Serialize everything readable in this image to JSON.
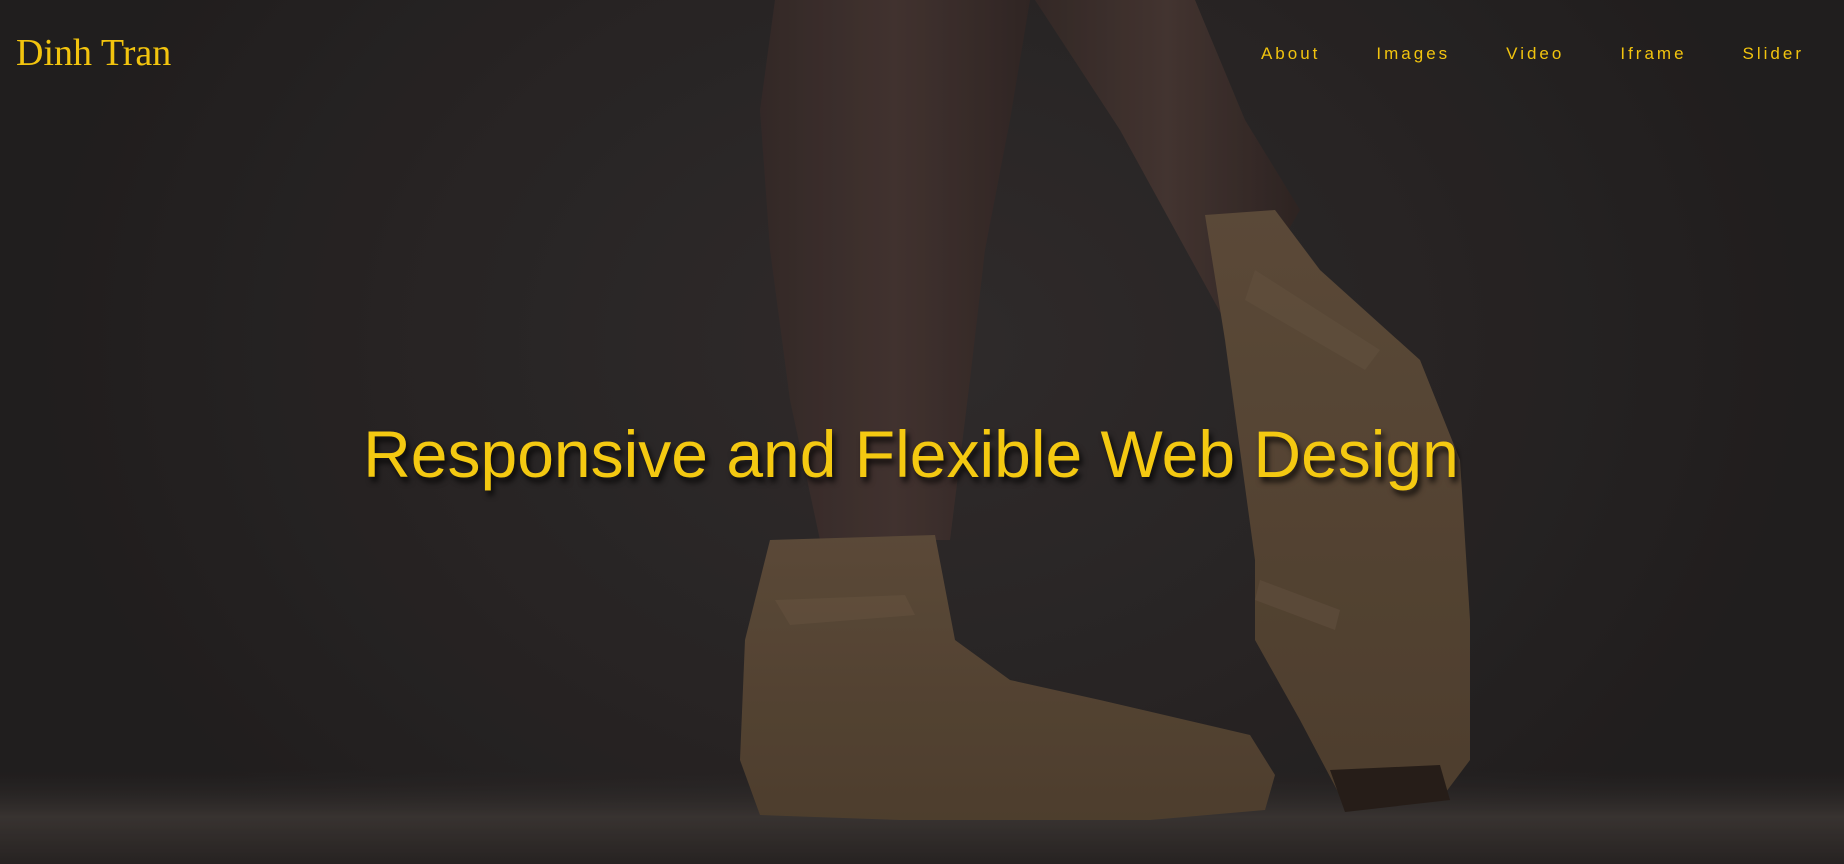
{
  "header": {
    "brand": "Dinh Tran",
    "nav": [
      {
        "label": "About"
      },
      {
        "label": "Images"
      },
      {
        "label": "Video"
      },
      {
        "label": "Iframe"
      },
      {
        "label": "Slider"
      }
    ]
  },
  "hero": {
    "headline": "Responsive and Flexible Web Design",
    "background_subject": "ballet-pointe-shoes-image"
  },
  "colors": {
    "accent": "#f2c40e",
    "background": "#2a2828"
  }
}
